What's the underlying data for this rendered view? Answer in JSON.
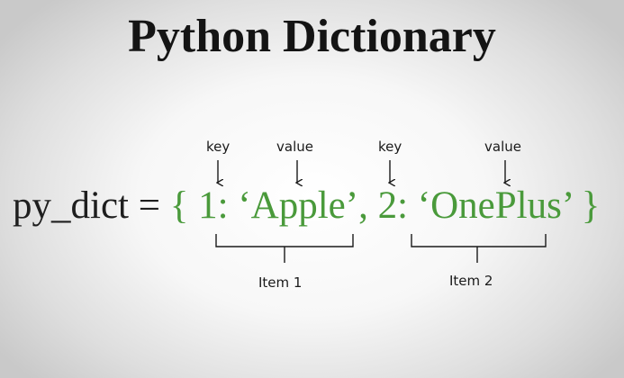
{
  "title": "Python Dictionary",
  "code": {
    "variable": "py_dict",
    "equals": "=",
    "open_brace": "{",
    "key1": "1",
    "colon1": ":",
    "value1": "‘Apple’",
    "comma": ",",
    "key2": "2",
    "colon2": ":",
    "value2": "‘OnePlus’",
    "close_brace": "}"
  },
  "annotations": {
    "key1_label": "key",
    "value1_label": "value",
    "key2_label": "key",
    "value2_label": "value",
    "item1_label": "Item 1",
    "item2_label": "Item 2"
  },
  "colors": {
    "dict_literal": "#4a9a3b",
    "text": "#1e1e1e"
  }
}
